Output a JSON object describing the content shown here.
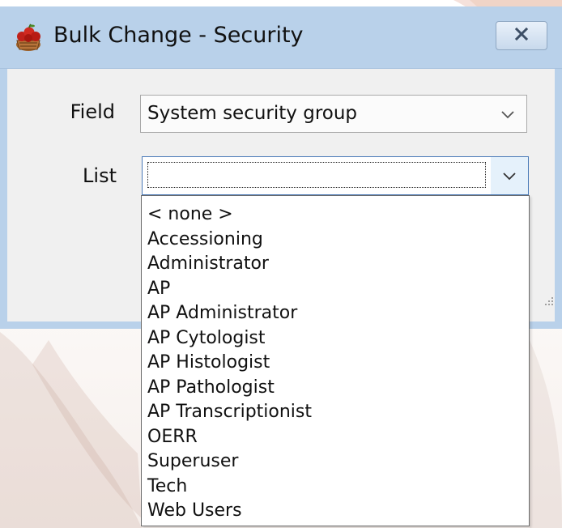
{
  "window": {
    "title": "Bulk Change - Security",
    "icon": "fruit-basket-icon",
    "close_icon": "close-icon"
  },
  "form": {
    "field_label": "Field",
    "field_value": "System security group",
    "list_label": "List",
    "list_value": ""
  },
  "dropdown": {
    "items": [
      "< none >",
      "Accessioning",
      "Administrator",
      "AP",
      "AP Administrator",
      "AP Cytologist",
      "AP Histologist",
      "AP Pathologist",
      "AP Transcriptionist",
      "OERR",
      "Superuser",
      "Tech",
      "Web Users"
    ]
  },
  "colors": {
    "titlebar": "#b9d1ea",
    "client": "#f0f0f0",
    "focus_border": "#4a7ab8"
  }
}
